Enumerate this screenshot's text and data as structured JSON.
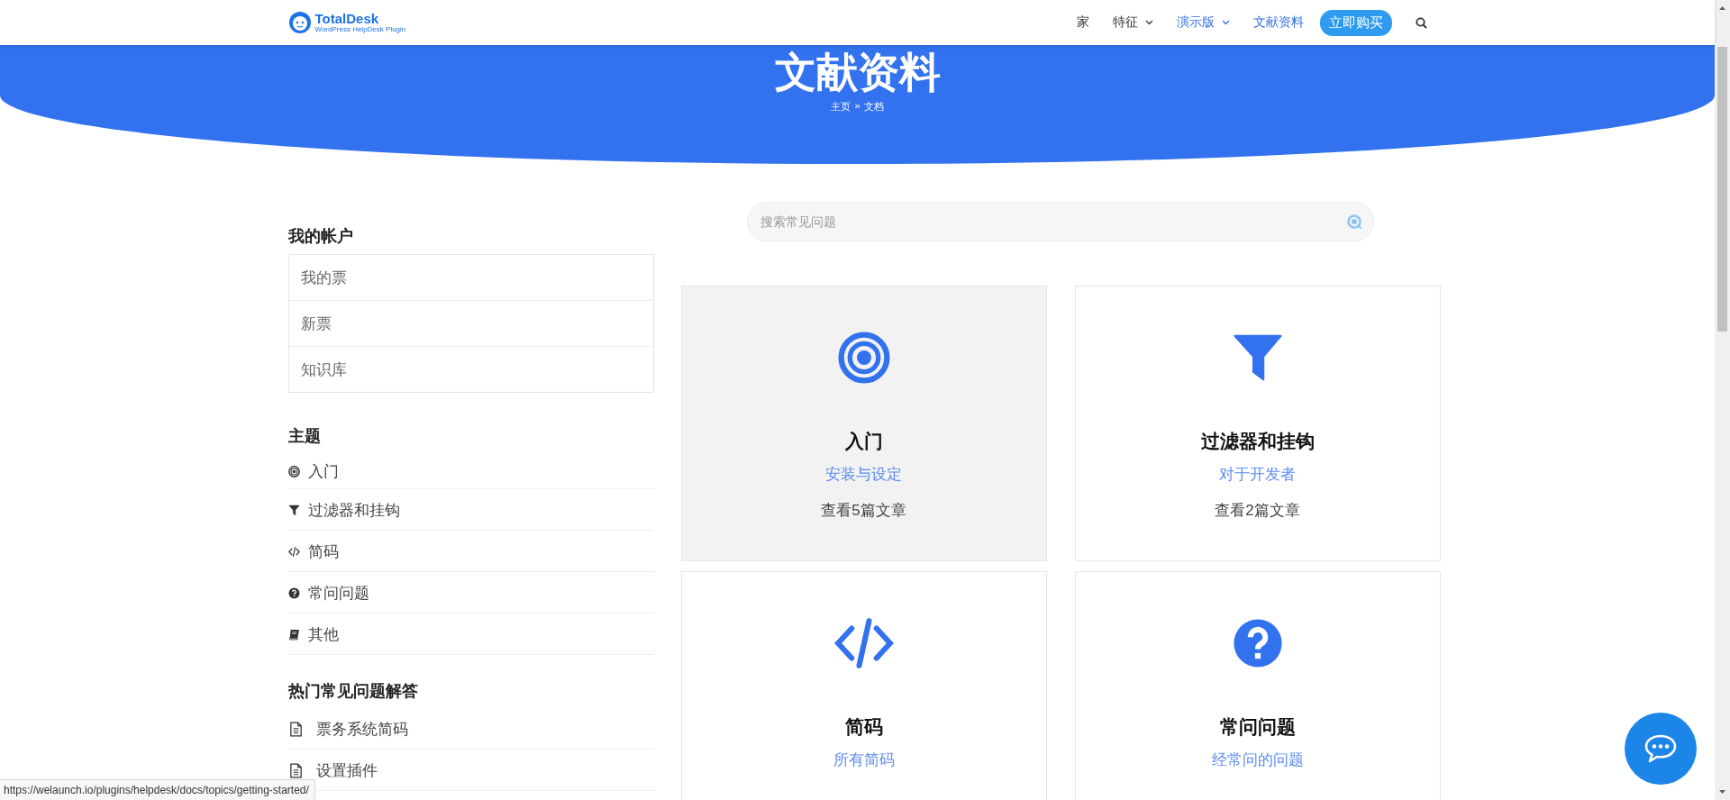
{
  "header": {
    "logo": {
      "name": "TotalDesk",
      "tagline": "WordPress HelpDesk Plugin"
    },
    "nav": [
      {
        "label": "家",
        "dropdown": false,
        "selected": false
      },
      {
        "label": "特征",
        "dropdown": true,
        "selected": false
      },
      {
        "label": "演示版",
        "dropdown": true,
        "selected": true
      },
      {
        "label": "文献资料",
        "dropdown": false,
        "selected": true
      }
    ],
    "cta": "立即购买"
  },
  "hero": {
    "title": "文献资料",
    "breadcrumb": [
      {
        "label": "主页"
      },
      {
        "label": "»"
      },
      {
        "label": "文档"
      }
    ]
  },
  "sidebar": {
    "account": {
      "title": "我的帐户",
      "items": [
        "我的票",
        "新票",
        "知识库"
      ]
    },
    "topics": {
      "title": "主题",
      "items": [
        {
          "kind": "target",
          "label": "入门"
        },
        {
          "kind": "filter",
          "label": "过滤器和挂钩"
        },
        {
          "kind": "code",
          "label": "简码"
        },
        {
          "kind": "question",
          "label": "常问问题"
        },
        {
          "kind": "book",
          "label": "其他"
        }
      ]
    },
    "popular": {
      "title": "热门常见问题解答",
      "items": [
        {
          "kind": "document",
          "label": "票务系统简码"
        },
        {
          "kind": "document",
          "label": "设置插件"
        }
      ]
    }
  },
  "search": {
    "placeholder": "搜索常见问题"
  },
  "cards": [
    {
      "kind": "target",
      "title": "入门",
      "subtitle": "安装与设定",
      "count": "查看5篇文章",
      "selected": true
    },
    {
      "kind": "filter",
      "title": "过滤器和挂钩",
      "subtitle": "对于开发者",
      "count": "查看2篇文章",
      "selected": false
    },
    {
      "kind": "code",
      "title": "简码",
      "subtitle": "所有简码",
      "selected": false
    },
    {
      "kind": "question",
      "title": "常问问题",
      "subtitle": "经常问的问题",
      "selected": false
    }
  ],
  "status_url": "https://welaunch.io/plugins/helpdesk/docs/topics/getting-started/"
}
